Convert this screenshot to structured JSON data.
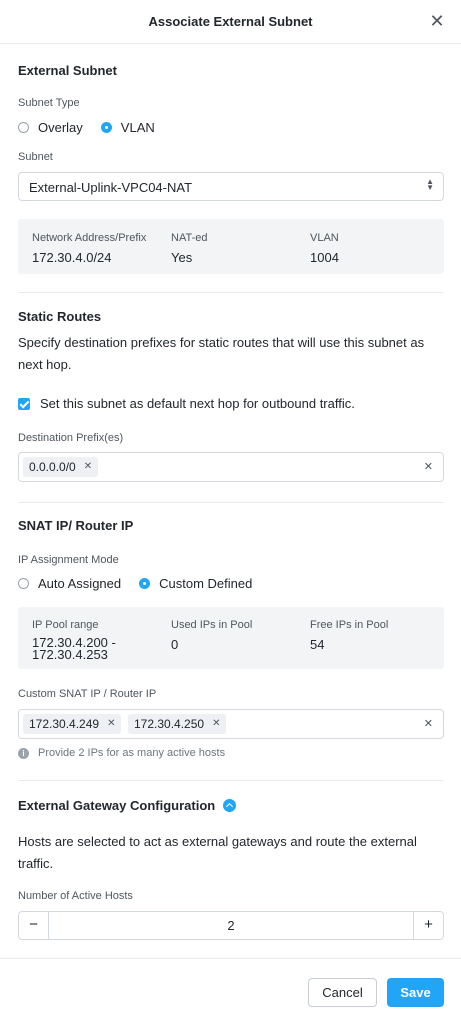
{
  "dialog": {
    "title": "Associate External Subnet"
  },
  "external_subnet": {
    "section_title": "External Subnet",
    "subnet_type_label": "Subnet Type",
    "options": {
      "overlay": "Overlay",
      "vlan": "VLAN"
    },
    "selected": "VLAN",
    "subnet_label": "Subnet",
    "subnet_value": "External-Uplink-VPC04-NAT",
    "info": {
      "network_label": "Network Address/Prefix",
      "network_value": "172.30.4.0/24",
      "nated_label": "NAT-ed",
      "nated_value": "Yes",
      "vlan_label": "VLAN",
      "vlan_value": "1004"
    }
  },
  "static_routes": {
    "section_title": "Static Routes",
    "description": "Specify destination prefixes for static routes that will use this subnet as next hop.",
    "default_hop_label": "Set this subnet as default next hop for outbound traffic.",
    "default_hop_checked": true,
    "destination_label": "Destination Prefix(es)",
    "prefixes": [
      "0.0.0.0/0"
    ]
  },
  "snat": {
    "section_title": "SNAT IP/ Router IP",
    "mode_label": "IP Assignment Mode",
    "options": {
      "auto": "Auto Assigned",
      "custom": "Custom Defined"
    },
    "selected": "Custom Defined",
    "pool": {
      "range_label": "IP Pool range",
      "range_value": "172.30.4.200 - 172.30.4.253",
      "used_label": "Used IPs in Pool",
      "used_value": "0",
      "free_label": "Free IPs in Pool",
      "free_value": "54"
    },
    "custom_label": "Custom SNAT IP / Router IP",
    "custom_ips": [
      "172.30.4.249",
      "172.30.4.250"
    ],
    "hint": "Provide 2 IPs for as many active hosts"
  },
  "gateway": {
    "section_title": "External Gateway Configuration",
    "description": "Hosts are selected to act as external gateways and route the external traffic.",
    "hosts_label": "Number of Active Hosts",
    "hosts_value": "2"
  },
  "footer": {
    "cancel_label": "Cancel",
    "save_label": "Save"
  },
  "colors": {
    "accent": "#22a5f7",
    "info_bg": "#f2f4f6"
  }
}
